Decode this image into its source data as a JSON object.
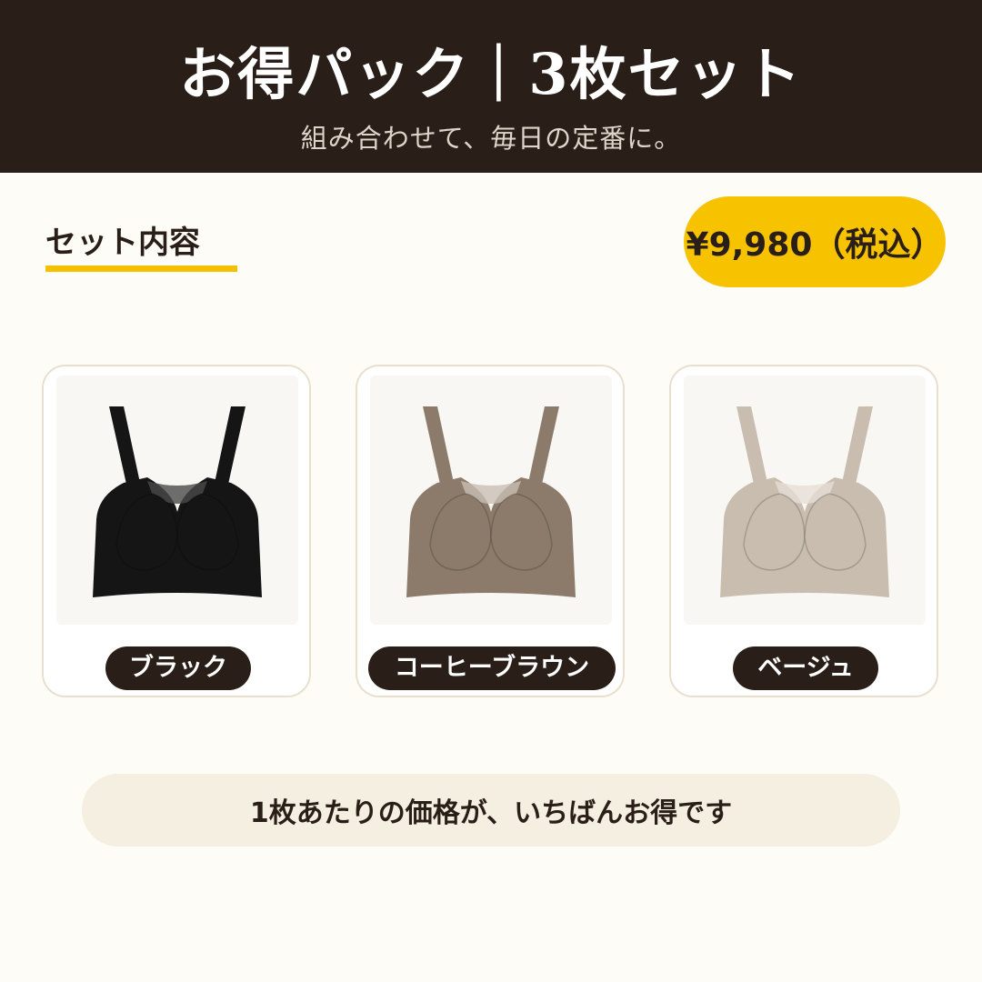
{
  "header": {
    "title": "お得パック｜3枚セット",
    "subtitle": "組み合わせて、毎日の定番に。"
  },
  "section": {
    "title": "セット内容"
  },
  "price": {
    "label": "¥9,980（税込）"
  },
  "products": [
    {
      "color_name": "ブラック",
      "swatch": "#151515",
      "lace": "#4a4a4a",
      "icon": "bra-image"
    },
    {
      "color_name": "コーヒーブラウン",
      "swatch": "#8c7b6a",
      "lace": "#c9bfb4",
      "icon": "bra-image"
    },
    {
      "color_name": "ベージュ",
      "swatch": "#c8bdaf",
      "lace": "#e6dfd6",
      "icon": "bra-image"
    }
  ],
  "footer": {
    "note": "1枚あたりの価格が、いちばんお得です"
  },
  "colors": {
    "header_bg": "#2a1f18",
    "accent_yellow": "#f7c300",
    "page_bg": "#fdfcf6"
  }
}
